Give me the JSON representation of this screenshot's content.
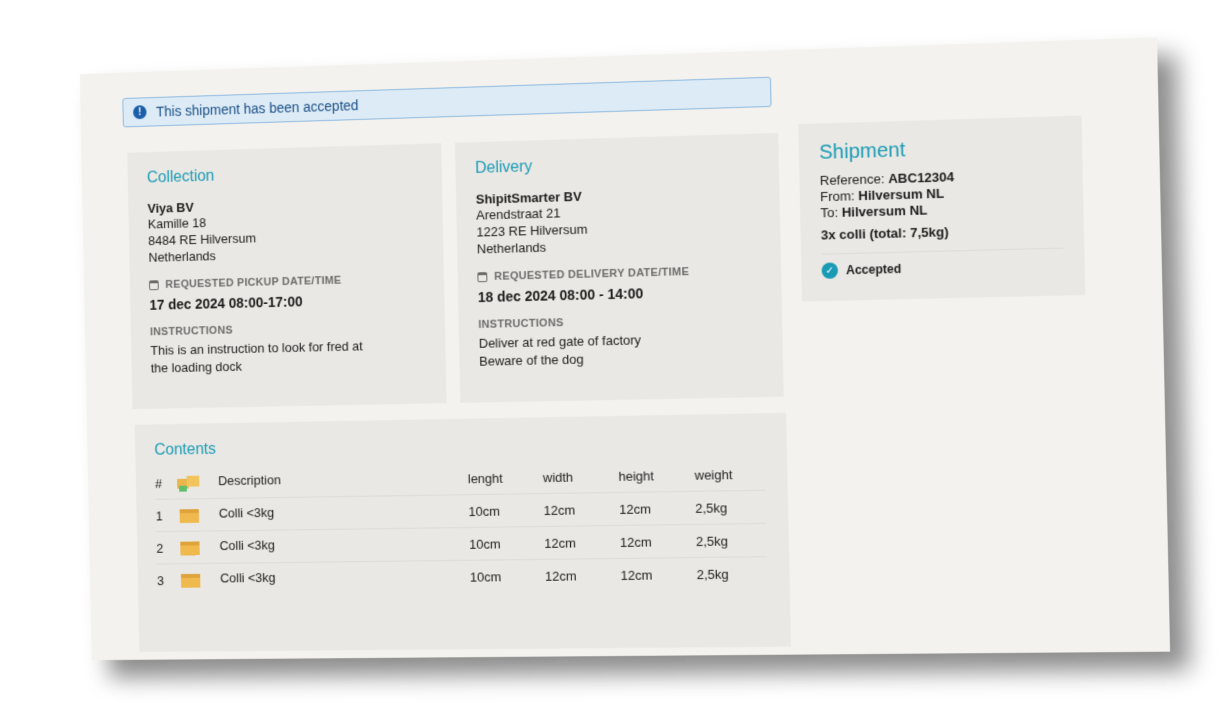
{
  "alert": {
    "text": "This shipment has been accepted"
  },
  "collection": {
    "title": "Collection",
    "company": "Viya BV",
    "street": "Kamille 18",
    "city": "8484 RE Hilversum",
    "country": "Netherlands",
    "datetime_label": "REQUESTED PICKUP DATE/TIME",
    "datetime": "17 dec 2024  08:00-17:00",
    "instructions_label": "INSTRUCTIONS",
    "instructions": [
      "This is an instruction to look for fred at",
      "the loading dock"
    ]
  },
  "delivery": {
    "title": "Delivery",
    "company": "ShipitSmarter BV",
    "street": "Arendstraat 21",
    "city": "1223 RE Hilversum",
    "country": "Netherlands",
    "datetime_label": "REQUESTED DELIVERY DATE/TIME",
    "datetime": "18 dec 2024 08:00 - 14:00",
    "instructions_label": "INSTRUCTIONS",
    "instructions": [
      "Deliver at red gate of factory",
      "Beware of the dog"
    ]
  },
  "shipment": {
    "title": "Shipment",
    "reference_label": "Reference:",
    "reference": "ABC12304",
    "from_label": "From:",
    "from": "Hilversum NL",
    "to_label": "To:",
    "to": "Hilversum NL",
    "summary": "3x colli (total: 7,5kg)",
    "status": "Accepted"
  },
  "contents": {
    "title": "Contents",
    "headers": {
      "num": "#",
      "description": "Description",
      "length": "lenght",
      "width": "width",
      "height": "height",
      "weight": "weight"
    },
    "rows": [
      {
        "num": "1",
        "description": "Colli <3kg",
        "length": "10cm",
        "width": "12cm",
        "height": "12cm",
        "weight": "2,5kg"
      },
      {
        "num": "2",
        "description": "Colli <3kg",
        "length": "10cm",
        "width": "12cm",
        "height": "12cm",
        "weight": "2,5kg"
      },
      {
        "num": "3",
        "description": "Colli <3kg",
        "length": "10cm",
        "width": "12cm",
        "height": "12cm",
        "weight": "2,5kg"
      }
    ]
  },
  "colors": {
    "accent": "#1a9bb5",
    "info": "#1b5fa8"
  }
}
